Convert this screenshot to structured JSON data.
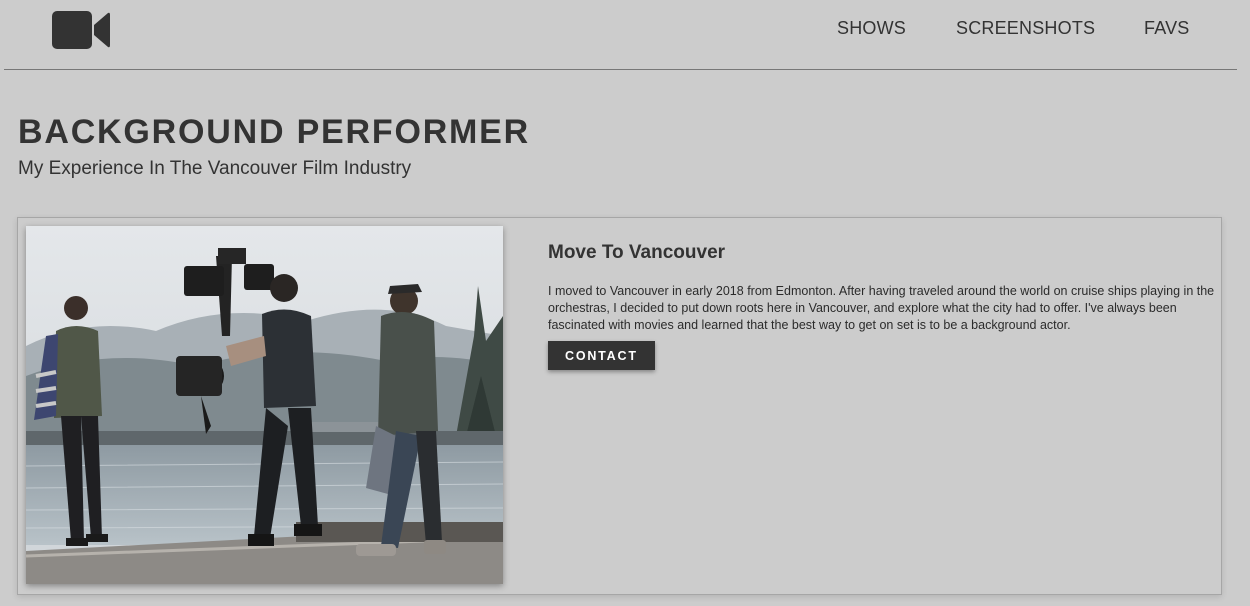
{
  "header": {
    "logo_icon": "video-camera-icon",
    "nav": {
      "shows": "SHOWS",
      "screenshots": "SCREENSHOTS",
      "favs": "FAVS"
    }
  },
  "hero": {
    "title": "BACKGROUND PERFORMER",
    "subtitle": "My Experience In The Vancouver Film Industry"
  },
  "card": {
    "photo_alt": "Film crew with camera rig walking on a lake dock",
    "title": "Move To Vancouver",
    "text": "I moved to Vancouver in early 2018 from Edmonton. After having traveled around the world on cruise ships playing in the orchestras, I decided to put down roots here in Vancouver, and explore what the city had to offer. I've always been fascinated with movies and learned that the best way to get on set is to be a background actor.",
    "button": "CONTACT"
  },
  "colors": {
    "background": "#cccccc",
    "text": "#333333",
    "button_bg": "#333333",
    "button_text": "#ffffff"
  }
}
